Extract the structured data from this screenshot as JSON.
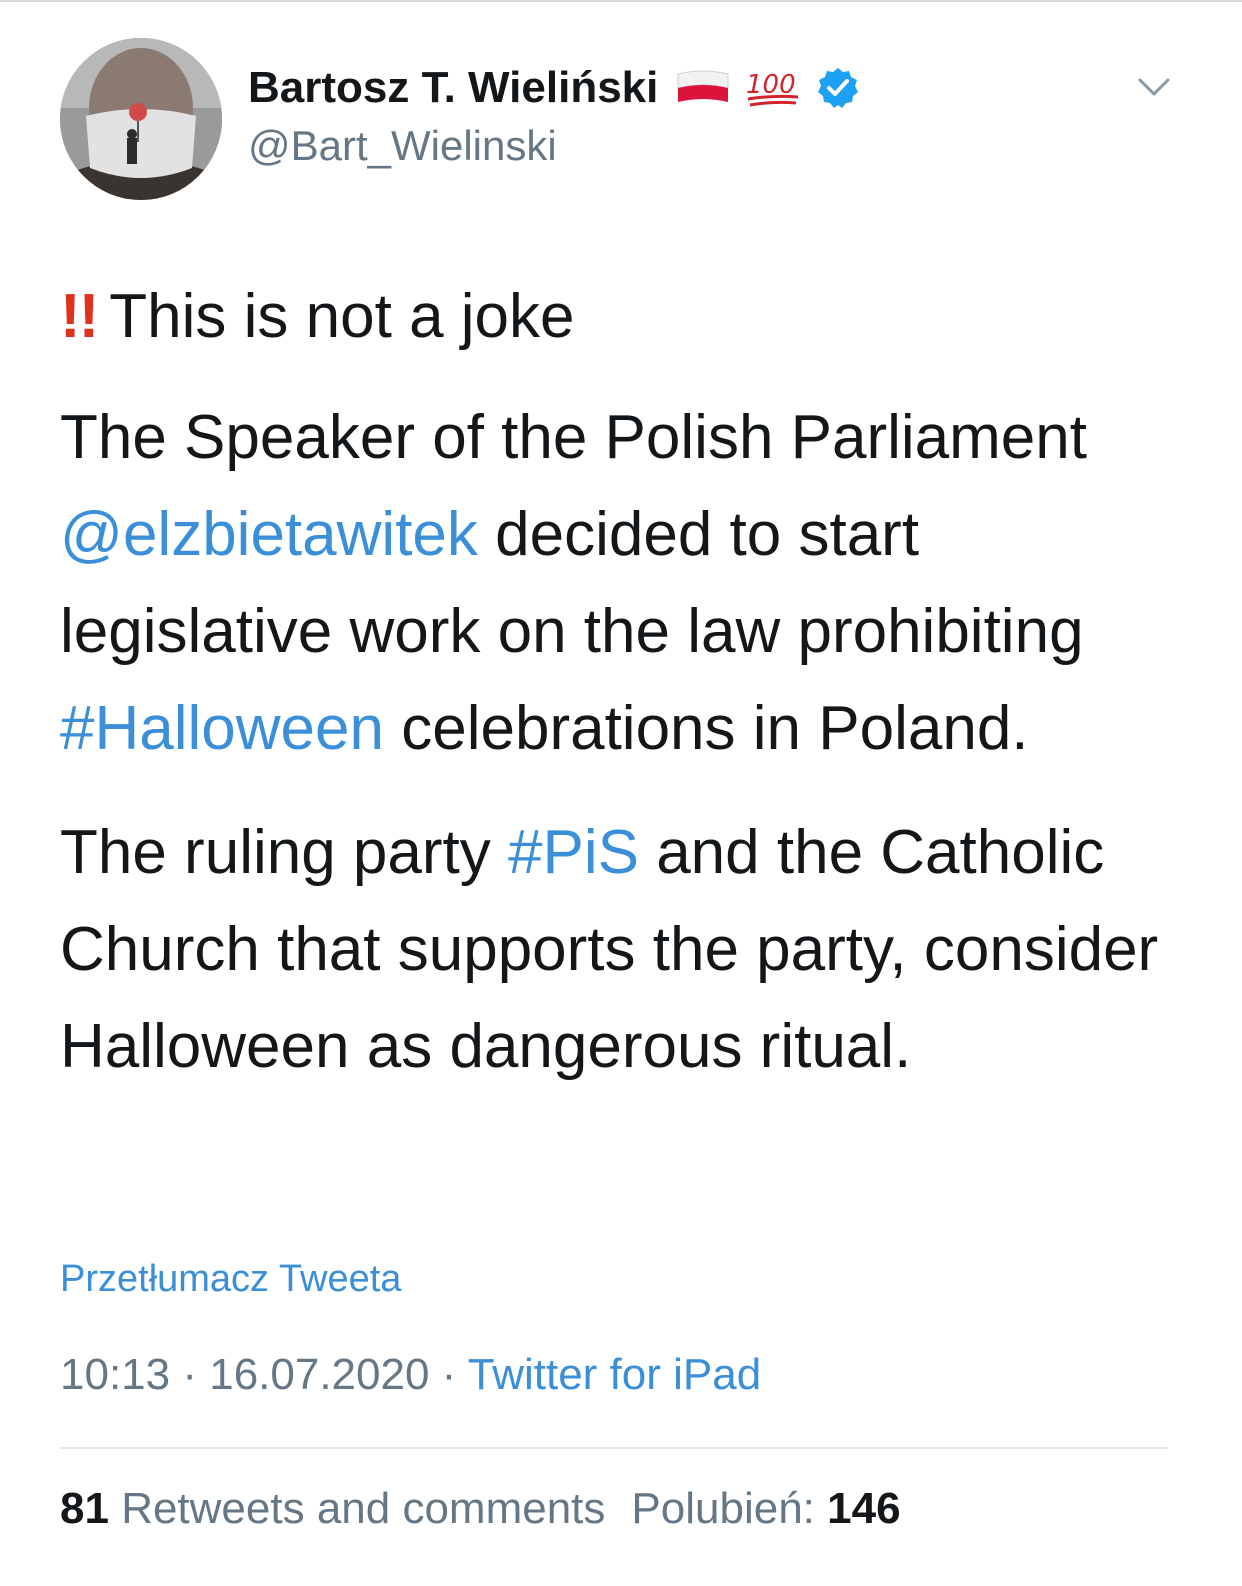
{
  "user": {
    "display_name": "Bartosz T. Wieliński",
    "handle": "@Bart_Wielinski",
    "badges": [
      "poland-flag-icon",
      "hundred-points-icon",
      "verified-icon"
    ]
  },
  "tweet": {
    "line1": "This is not a joke",
    "p2_text1": "The Speaker of the Polish Parliament ",
    "p2_mention": "@elzbietawitek",
    "p2_text2": " decided to start legislative work on the law prohibiting ",
    "p2_hashtag": "#Halloween",
    "p2_text3": " celebrations in Poland.",
    "p3_text1": "The ruling party ",
    "p3_hashtag": "#PiS",
    "p3_text2": " and the Catholic Church that supports the party, consider Halloween as dangerous ritual."
  },
  "translate_label": "Przetłumacz Tweeta",
  "meta": {
    "time": "10:13",
    "separator": " · ",
    "date": "16.07.2020",
    "source": "Twitter for iPad"
  },
  "stats": {
    "retweets_count": "81",
    "retweets_label": "Retweets and comments",
    "likes_label": "Polubień:",
    "likes_count": "146"
  },
  "colors": {
    "link": "#3b8fd9",
    "secondary_text": "#657786",
    "primary_text": "#14171a",
    "verified": "#1da1f2",
    "alert": "#e0301e"
  }
}
